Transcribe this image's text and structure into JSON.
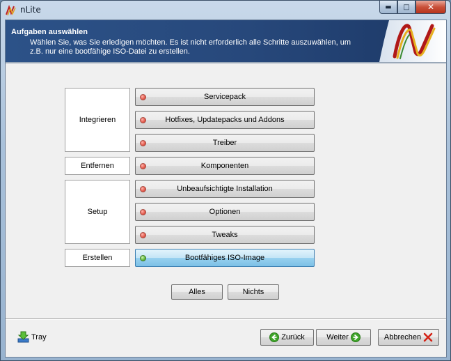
{
  "window": {
    "title": "nLite",
    "minimize_glyph": "▬",
    "maximize_glyph": "□",
    "close_glyph": "✕"
  },
  "header": {
    "title": "Aufgaben auswählen",
    "description_line1": "Wählen Sie, was Sie erledigen möchten. Es ist nicht erforderlich alle Schritte auszuwählen, um",
    "description_line2": "z.B. nur eine bootfähige ISO-Datei zu erstellen."
  },
  "groups": {
    "integrate": "Integrieren",
    "remove": "Entfernen",
    "setup": "Setup",
    "create": "Erstellen"
  },
  "tasks": [
    {
      "label": "Servicepack",
      "status": "red"
    },
    {
      "label": "Hotfixes, Updatepacks und Addons",
      "status": "red"
    },
    {
      "label": "Treiber",
      "status": "red"
    },
    {
      "label": "Komponenten",
      "status": "red"
    },
    {
      "label": "Unbeaufsichtigte Installation",
      "status": "red"
    },
    {
      "label": "Optionen",
      "status": "red"
    },
    {
      "label": "Tweaks",
      "status": "red"
    },
    {
      "label": "Bootfähiges ISO-Image",
      "status": "green",
      "selected": true
    }
  ],
  "selection": {
    "all_label": "Alles",
    "none_label": "Nichts"
  },
  "footer": {
    "tray_label": "Tray",
    "back_label": "Zurück",
    "next_label": "Weiter",
    "cancel_label": "Abbrechen"
  },
  "colors": {
    "header_bg": "#2c5288",
    "status_red": "#e25a4c",
    "status_green": "#5fb83a",
    "selected_button": "#98d1ef"
  },
  "icons": {
    "app": "nlite-logo-icon",
    "tray": "tray-download-icon",
    "back": "green-arrow-left-icon",
    "next": "green-arrow-right-icon",
    "cancel": "red-x-icon"
  }
}
